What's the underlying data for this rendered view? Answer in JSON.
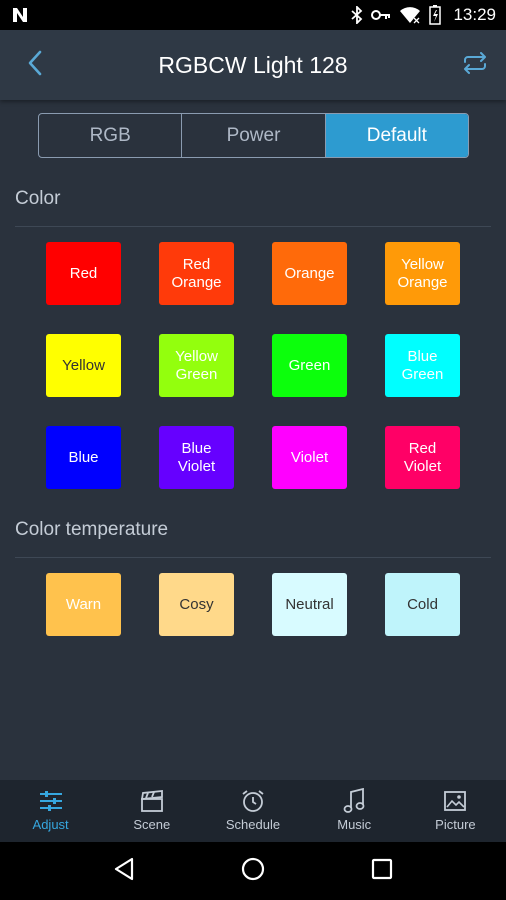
{
  "status_bar": {
    "time": "13:29",
    "icons": [
      "n-logo-icon",
      "bluetooth-icon",
      "key-icon",
      "wifi-icon",
      "battery-icon"
    ]
  },
  "header": {
    "title": "RGBCW Light 128",
    "back_icon": "chevron-left-icon",
    "sync_icon": "repeat-icon"
  },
  "segments": [
    {
      "label": "RGB",
      "active": false
    },
    {
      "label": "Power",
      "active": false
    },
    {
      "label": "Default",
      "active": true
    }
  ],
  "color_section": {
    "title": "Color",
    "swatches": [
      {
        "label": "Red",
        "color": "#ff0000",
        "text_color": "#ffffff"
      },
      {
        "label": "Red\nOrange",
        "color": "#ff3a0a",
        "text_color": "#ffffff"
      },
      {
        "label": "Orange",
        "color": "#ff6a0a",
        "text_color": "#ffffff"
      },
      {
        "label": "Yellow\nOrange",
        "color": "#ff9a08",
        "text_color": "#ffffff"
      },
      {
        "label": "Yellow",
        "color": "#ffff00",
        "text_color": "#333333"
      },
      {
        "label": "Yellow\nGreen",
        "color": "#93ff0d",
        "text_color": "#ffffff"
      },
      {
        "label": "Green",
        "color": "#0cff0c",
        "text_color": "#ffffff"
      },
      {
        "label": "Blue\nGreen",
        "color": "#00ffff",
        "text_color": "#ffffff"
      },
      {
        "label": "Blue",
        "color": "#0000ff",
        "text_color": "#ffffff"
      },
      {
        "label": "Blue\nViolet",
        "color": "#6600ff",
        "text_color": "#ffffff"
      },
      {
        "label": "Violet",
        "color": "#ff00ff",
        "text_color": "#ffffff"
      },
      {
        "label": "Red\nViolet",
        "color": "#ff0066",
        "text_color": "#ffffff"
      }
    ]
  },
  "temp_section": {
    "title": "Color temperature",
    "swatches": [
      {
        "label": "Warn",
        "color": "#ffc24d",
        "text_color": "#ffffff"
      },
      {
        "label": "Cosy",
        "color": "#ffd98a",
        "text_color": "#333333"
      },
      {
        "label": "Neutral",
        "color": "#d8fbff",
        "text_color": "#333333"
      },
      {
        "label": "Cold",
        "color": "#bff4fb",
        "text_color": "#333333"
      }
    ]
  },
  "tabs": [
    {
      "label": "Adjust",
      "icon": "sliders-icon",
      "active": true
    },
    {
      "label": "Scene",
      "icon": "clapperboard-icon",
      "active": false
    },
    {
      "label": "Schedule",
      "icon": "alarm-clock-icon",
      "active": false
    },
    {
      "label": "Music",
      "icon": "music-note-icon",
      "active": false
    },
    {
      "label": "Picture",
      "icon": "image-icon",
      "active": false
    }
  ],
  "colors": {
    "accent": "#2d9bd0",
    "background": "#2a323d",
    "header": "#2f3945",
    "tab_bar": "#1e252e"
  }
}
